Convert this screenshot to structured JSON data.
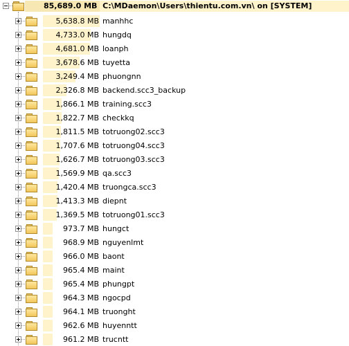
{
  "root": {
    "size": "85,689.0 MB",
    "path": "C:\\MDaemon\\Users\\thientu.com.vn\\ on [SYSTEM]",
    "expanded": true
  },
  "folders": [
    {
      "size": "5,638.8 MB",
      "name": "manhhc",
      "size_mb": 5638.8
    },
    {
      "size": "4,733.0 MB",
      "name": "hungdq",
      "size_mb": 4733.0
    },
    {
      "size": "4,681.0 MB",
      "name": "loanph",
      "size_mb": 4681.0
    },
    {
      "size": "3,678.6 MB",
      "name": "tuyetta",
      "size_mb": 3678.6
    },
    {
      "size": "3,249.4 MB",
      "name": "phuongnn",
      "size_mb": 3249.4
    },
    {
      "size": "2,326.8 MB",
      "name": "backend.scc3_backup",
      "size_mb": 2326.8
    },
    {
      "size": "1,866.1 MB",
      "name": "training.scc3",
      "size_mb": 1866.1
    },
    {
      "size": "1,822.7 MB",
      "name": "checkkq",
      "size_mb": 1822.7
    },
    {
      "size": "1,811.5 MB",
      "name": "totruong02.scc3",
      "size_mb": 1811.5
    },
    {
      "size": "1,707.6 MB",
      "name": "totruong04.scc3",
      "size_mb": 1707.6
    },
    {
      "size": "1,626.7 MB",
      "name": "totruong03.scc3",
      "size_mb": 1626.7
    },
    {
      "size": "1,569.9 MB",
      "name": "qa.scc3",
      "size_mb": 1569.9
    },
    {
      "size": "1,420.4 MB",
      "name": "truongca.scc3",
      "size_mb": 1420.4
    },
    {
      "size": "1,413.3 MB",
      "name": "diepnt",
      "size_mb": 1413.3
    },
    {
      "size": "1,369.5 MB",
      "name": "totruong01.scc3",
      "size_mb": 1369.5
    },
    {
      "size": "973.7 MB",
      "name": "hungct",
      "size_mb": 973.7
    },
    {
      "size": "968.9 MB",
      "name": "nguyenlmt",
      "size_mb": 968.9
    },
    {
      "size": "966.0 MB",
      "name": "baont",
      "size_mb": 966.0
    },
    {
      "size": "965.4 MB",
      "name": "maint",
      "size_mb": 965.4
    },
    {
      "size": "965.4 MB",
      "name": "phungpt",
      "size_mb": 965.4
    },
    {
      "size": "964.3 MB",
      "name": "ngocpd",
      "size_mb": 964.3
    },
    {
      "size": "964.1 MB",
      "name": "truonght",
      "size_mb": 964.1
    },
    {
      "size": "962.6 MB",
      "name": "huyenntt",
      "size_mb": 962.6
    },
    {
      "size": "961.2 MB",
      "name": "trucntt",
      "size_mb": 961.2
    }
  ],
  "icons": {
    "folder": "folder-icon",
    "expand": "plus-expander-icon",
    "collapse": "minus-expander-icon"
  },
  "colors": {
    "bar": "#fff3cc",
    "folder": "#f2c75a"
  }
}
